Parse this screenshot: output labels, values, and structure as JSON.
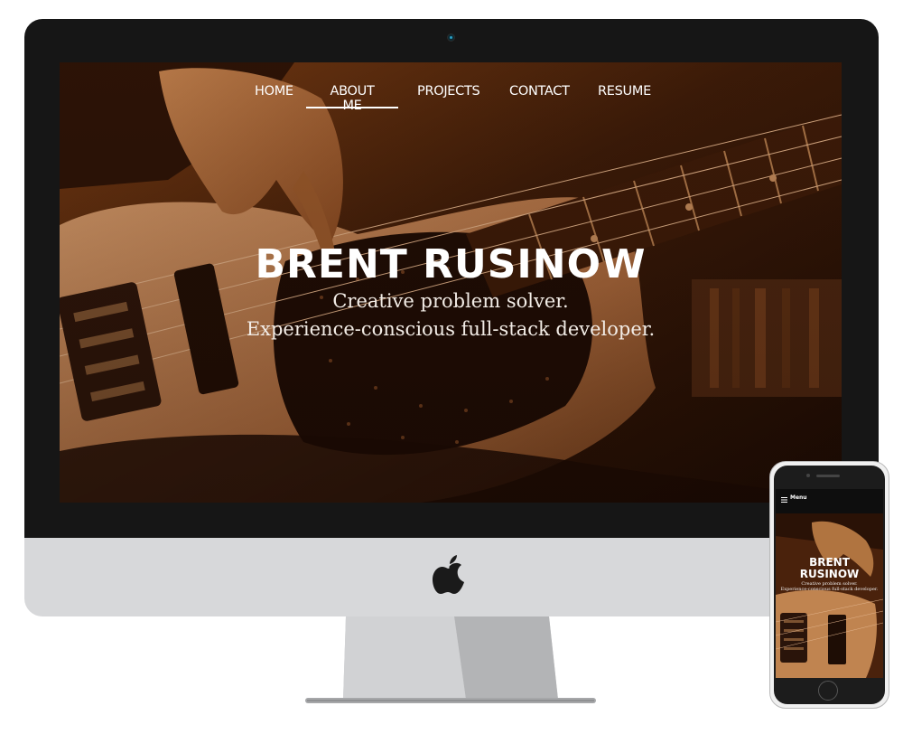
{
  "nav": {
    "items": [
      {
        "label": "HOME"
      },
      {
        "label": "ABOUT ME",
        "active": true
      },
      {
        "label": "PROJECTS"
      },
      {
        "label": "CONTACT"
      },
      {
        "label": "RESUME"
      }
    ]
  },
  "hero": {
    "title": "BRENT RUSINOW",
    "subtitle_line1": "Creative problem solver.",
    "subtitle_line2": "Experience-conscious full-stack developer."
  },
  "mobile": {
    "menu_label": "Menu",
    "title_line1": "BRENT",
    "title_line2": "RUSINOW",
    "subtitle_line1": "Creative problem solver.",
    "subtitle_line2": "Experience-conscious full-stack developer."
  },
  "colors": {
    "hero_tint": "#b5652a",
    "bezel": "#161616",
    "chin": "#d7d8da",
    "stand": "#c7c8ca"
  },
  "icons": {
    "brand": "apple-logo",
    "mobile_menu": "hamburger-icon"
  }
}
